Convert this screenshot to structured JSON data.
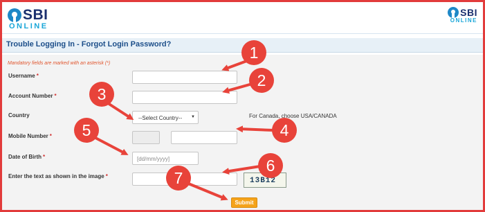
{
  "brand": {
    "sbi": "SBI",
    "online": "ONLINE"
  },
  "page": {
    "title": "Trouble Logging In - Forgot Login Password?"
  },
  "form": {
    "mandatory_note": "Mandatory fields are marked with an asterisk (*)",
    "required_marker": "*",
    "username_label": "Username",
    "account_label": "Account Number",
    "country_label": "Country",
    "country_selected": "--Select Country--",
    "country_note": "For Canada, choose USA/CANADA",
    "mobile_label": "Mobile Number",
    "dob_label": "Date of Birth",
    "dob_placeholder": "[dd/mm/yyyy]",
    "captcha_label": "Enter the text as shown in the image",
    "captcha_text": "13B12",
    "submit_label": "Submit"
  },
  "annotations": [
    "1",
    "2",
    "3",
    "4",
    "5",
    "6",
    "7"
  ],
  "colors": {
    "frame": "#e23b3b",
    "annotation": "#e8433a",
    "title": "#1d4f8a",
    "submit": "#f5a31a",
    "brand_dark": "#1a2f6e",
    "brand_light": "#19a6d8"
  }
}
